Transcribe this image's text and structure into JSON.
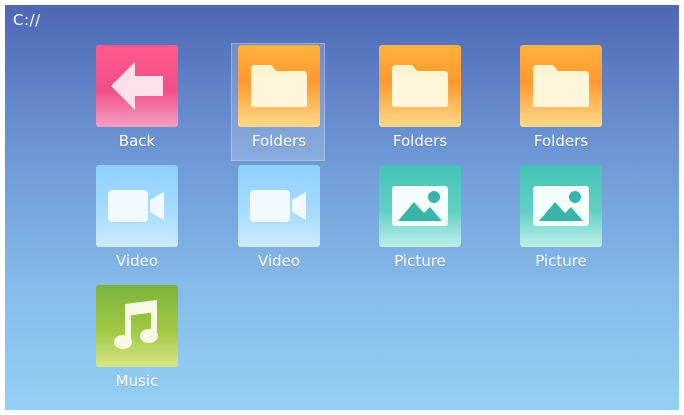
{
  "window": {
    "path": "C://"
  },
  "tiles": [
    {
      "label": "Back",
      "icon": "back-arrow-icon"
    },
    {
      "label": "Folders",
      "icon": "folder-icon",
      "selected": true
    },
    {
      "label": "Folders",
      "icon": "folder-icon"
    },
    {
      "label": "Folders",
      "icon": "folder-icon"
    },
    {
      "label": "Video",
      "icon": "video-camera-icon"
    },
    {
      "label": "Video",
      "icon": "video-camera-icon"
    },
    {
      "label": "Picture",
      "icon": "picture-icon"
    },
    {
      "label": "Picture",
      "icon": "picture-icon"
    },
    {
      "label": "Music",
      "icon": "music-note-icon"
    }
  ],
  "colors": {
    "background_top": "#4f67b6",
    "background_bottom": "#95cff3",
    "back": "#f04e86",
    "folder": "#ff9a2f",
    "video": "#a8ddff",
    "picture": "#44c2b6",
    "music": "#a1c742"
  }
}
